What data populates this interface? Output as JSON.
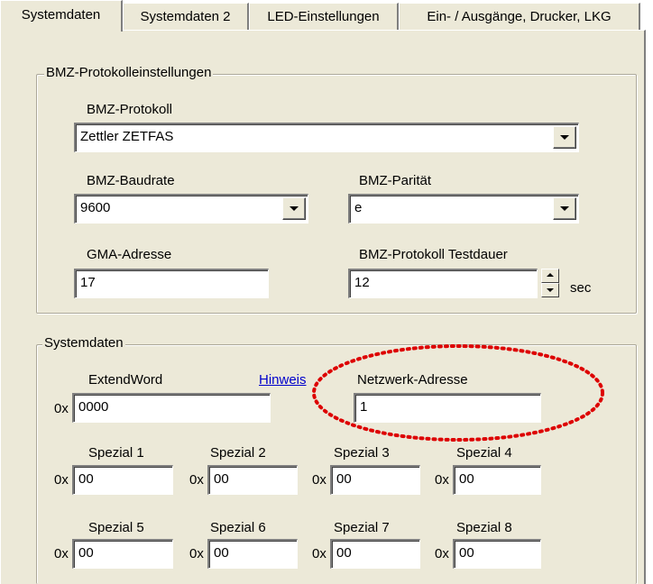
{
  "tabs": [
    {
      "label": "Systemdaten"
    },
    {
      "label": "Systemdaten 2"
    },
    {
      "label": "LED-Einstellungen"
    },
    {
      "label": "Ein- / Ausgänge, Drucker, LKG"
    }
  ],
  "bmz_group": {
    "title": "BMZ-Protokolleinstellungen",
    "protokoll_label": "BMZ-Protokoll",
    "protokoll_value": "Zettler ZETFAS",
    "baudrate_label": "BMZ-Baudrate",
    "baudrate_value": "9600",
    "paritaet_label": "BMZ-Parität",
    "paritaet_value": "e",
    "gma_label": "GMA-Adresse",
    "gma_value": "17",
    "testdauer_label": "BMZ-Protokoll Testdauer",
    "testdauer_value": "12",
    "testdauer_unit": "sec"
  },
  "sys_group": {
    "title": "Systemdaten",
    "prefix": "0x",
    "extendword_label": "ExtendWord",
    "extendword_value": "0000",
    "hinweis_link": "Hinweis",
    "netzwerk_label": "Netzwerk-Adresse",
    "netzwerk_value": "1",
    "spezial": [
      {
        "label": "Spezial 1",
        "value": "00"
      },
      {
        "label": "Spezial 2",
        "value": "00"
      },
      {
        "label": "Spezial 3",
        "value": "00"
      },
      {
        "label": "Spezial 4",
        "value": "00"
      },
      {
        "label": "Spezial 5",
        "value": "00"
      },
      {
        "label": "Spezial 6",
        "value": "00"
      },
      {
        "label": "Spezial 7",
        "value": "00"
      },
      {
        "label": "Spezial 8",
        "value": "00"
      }
    ]
  },
  "colors": {
    "panel": "#ece9d8",
    "highlight_ellipse": "#dd0000",
    "link": "#0000cc"
  }
}
